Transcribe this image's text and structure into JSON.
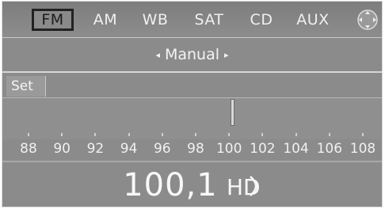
{
  "tabs": [
    {
      "label": "FM",
      "active": true
    },
    {
      "label": "AM",
      "active": false
    },
    {
      "label": "WB",
      "active": false
    },
    {
      "label": "SAT",
      "active": false
    },
    {
      "label": "CD",
      "active": false
    },
    {
      "label": "AUX",
      "active": false
    }
  ],
  "mode": {
    "label": "Manual"
  },
  "set_button": {
    "label": "Set"
  },
  "scale": {
    "labels": [
      "88",
      "90",
      "92",
      "94",
      "96",
      "98",
      "100",
      "102",
      "104",
      "106",
      "108"
    ]
  },
  "current_frequency": "100,1",
  "hd_badge": "HD",
  "colors": {
    "background": "#8b8b8b",
    "text": "#f0f0f0",
    "active_border": "#222222"
  },
  "icons": [
    "controller-dpad-icon",
    "left-arrow-icon",
    "right-arrow-icon",
    "hd-radio-icon"
  ]
}
